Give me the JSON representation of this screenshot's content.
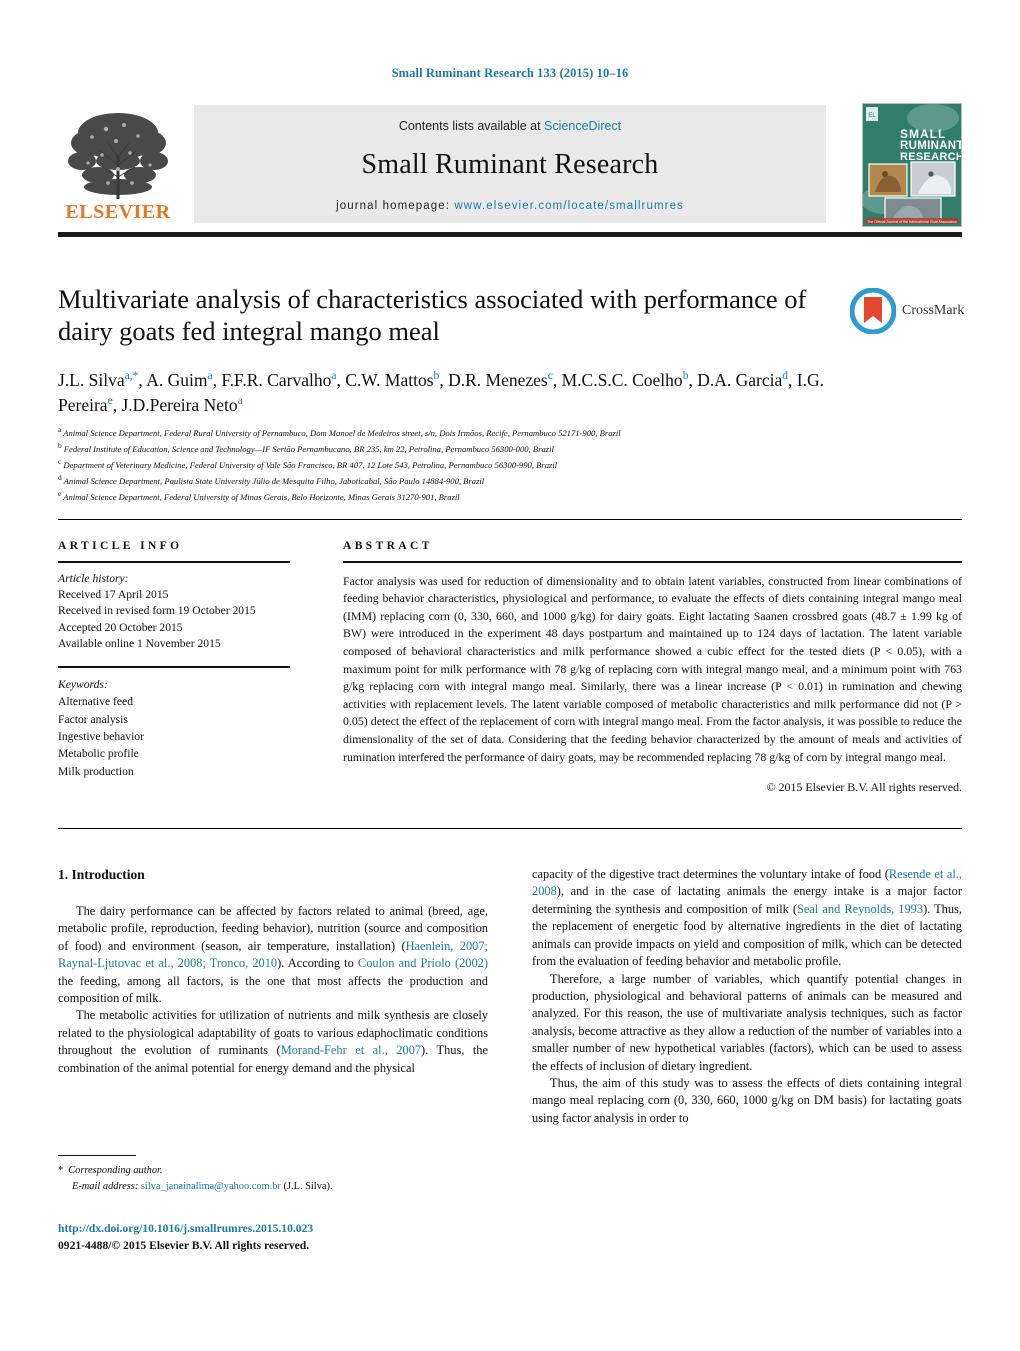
{
  "running_head": "Small Ruminant Research 133 (2015) 10–16",
  "masthead": {
    "contents_prefix": "Contents lists available at ",
    "sciencedirect": "ScienceDirect",
    "journal_name": "Small Ruminant Research",
    "homepage_prefix": "journal homepage: ",
    "homepage_url": "www.elsevier.com/locate/smallrumres",
    "publisher_wordmark": "ELSEVIER",
    "cover_title_lines": [
      "SMALL",
      "RUMINANT",
      "RESEARCH"
    ],
    "cover_footer": "The Official Journal of the International Goat Association",
    "accent_color": "#1b7ba8",
    "elsevier_orange": "#e87722",
    "cover_green": "#2f7d6b"
  },
  "article": {
    "title": "Multivariate analysis of characteristics associated with performance of dairy goats fed integral mango meal",
    "authors_line1": "J.L. Silva",
    "authors": [
      {
        "name": "J.L. Silva",
        "sup": "a,*"
      },
      {
        "name": "A. Guim",
        "sup": "a"
      },
      {
        "name": "F.F.R. Carvalho",
        "sup": "a"
      },
      {
        "name": "C.W. Mattos",
        "sup": "b"
      },
      {
        "name": "D.R. Menezes",
        "sup": "c"
      },
      {
        "name": "M.C.S.C. Coelho",
        "sup": "b"
      },
      {
        "name": "D.A. Garcia",
        "sup": "d"
      },
      {
        "name": "I.G. Pereira",
        "sup": "e"
      },
      {
        "name": "J.D.Pereira Neto",
        "sup": "a"
      }
    ],
    "affiliations": [
      {
        "sup": "a",
        "text": "Animal Science Department, Federal Rural University of Pernambuco, Dom Manoel de Medeiros street, s/n, Dois Irmãos, Recife, Pernambuco 52171-900, Brazil"
      },
      {
        "sup": "b",
        "text": "Federal Institute of Education, Science and Technology—IF Sertão Pernambucano, BR 235, km 22, Petrolina, Pernambuco 56300-000, Brazil"
      },
      {
        "sup": "c",
        "text": "Department of Veterinary Medicine, Federal University of Vale São Francisco, BR 407, 12 Lote 543, Petrolina, Pernambuco 56300-990, Brazil"
      },
      {
        "sup": "d",
        "text": "Animal Science Department, Paulista State University Júlio de Mesquita Filho, Jaboticabal, São Paulo 14884-900, Brazil"
      },
      {
        "sup": "e",
        "text": "Animal Science Department, Federal University of Minas Gerais, Belo Horizonte, Minas Gerais 31270-901, Brazil"
      }
    ],
    "crossmark_label": "CrossMark"
  },
  "article_info": {
    "heading": "ARTICLE INFO",
    "history_label": "Article history:",
    "history": [
      "Received 17 April 2015",
      "Received in revised form 19 October 2015",
      "Accepted 20 October 2015",
      "Available online 1 November 2015"
    ],
    "keywords_label": "Keywords:",
    "keywords": [
      "Alternative feed",
      "Factor analysis",
      "Ingestive behavior",
      "Metabolic profile",
      "Milk production"
    ]
  },
  "abstract": {
    "heading": "ABSTRACT",
    "body": "Factor analysis was used for reduction of dimensionality and to obtain latent variables, constructed from linear combinations of feeding behavior characteristics, physiological and performance, to evaluate the effects of diets containing integral mango meal (IMM) replacing corn (0, 330, 660, and 1000 g/kg) for dairy goats. Eight lactating Saanen crossbred goats (48.7 ± 1.99 kg of BW) were introduced in the experiment 48 days postpartum and maintained up to 124 days of lactation. The latent variable composed of behavioral characteristics and milk performance showed a cubic effect for the tested diets (P < 0.05), with a maximum point for milk performance with 78 g/kg of replacing corn with integral mango meal, and a minimum point with 763 g/kg replacing corn with integral mango meal. Similarly, there was a linear increase (P < 0.01) in rumination and chewing activities with replacement levels. The latent variable composed of metabolic characteristics and milk performance did not (P > 0.05) detect the effect of the replacement of corn with integral mango meal. From the factor analysis, it was possible to reduce the dimensionality of the set of data. Considering that the feeding behavior characterized by the amount of meals and activities of rumination interfered the performance of dairy goats, may be recommended replacing 78 g/kg of corn by integral mango meal.",
    "copyright": "© 2015 Elsevier B.V. All rights reserved."
  },
  "introduction": {
    "heading": "1. Introduction",
    "left_paragraphs": [
      "The dairy performance can be affected by factors related to animal (breed, age, metabolic profile, reproduction, feeding behavior), nutrition (source and composition of food) and environment (season, air temperature, installation) (CITE1). According to CITE2 the feeding, among all factors, is the one that most affects the production and composition of milk.",
      "The metabolic activities for utilization of nutrients and milk synthesis are closely related to the physiological adaptability of goats to various edaphoclimatic conditions throughout the evolution of ruminants (CITE3). Thus, the combination of the animal potential for energy demand and the physical"
    ],
    "right_paragraphs": [
      "capacity of the digestive tract determines the voluntary intake of food (CITE4), and in the case of lactating animals the energy intake is a major factor determining the synthesis and composition of milk (CITE5). Thus, the replacement of energetic food by alternative ingredients in the diet of lactating animals can provide impacts on yield and composition of milk, which can be detected from the evaluation of feeding behavior and metabolic profile.",
      "Therefore, a large number of variables, which quantify potential changes in production, physiological and behavioral patterns of animals can be measured and analyzed. For this reason, the use of multivariate analysis techniques, such as factor analysis, become attractive as they allow a reduction of the number of variables into a smaller number of new hypothetical variables (factors), which can be used to assess the effects of inclusion of dietary ingredient.",
      "Thus, the aim of this study was to assess the effects of diets containing integral mango meal replacing corn (0, 330, 660, 1000 g/kg on DM basis) for lactating goats using factor analysis in order to"
    ],
    "citations": {
      "CITE1": "Haenlein, 2007; Raynal-Ljutovac et al., 2008; Tronco, 2010",
      "CITE2": "Coulon and Priolo (2002)",
      "CITE3": "Morand-Fehr et al., 2007",
      "CITE4": "Resende et al., 2008",
      "CITE5": "Seal and Reynolds, 1993"
    }
  },
  "footnote": {
    "corresponding_marker": "*",
    "corresponding_label": "Corresponding author.",
    "email_label": "E-mail address:",
    "email": "silva_janainalima@yahoo.com.br",
    "email_owner": "(J.L. Silva)."
  },
  "footer": {
    "doi": "http://dx.doi.org/10.1016/j.smallrumres.2015.10.023",
    "issn_line": "0921-4488/© 2015 Elsevier B.V. All rights reserved."
  }
}
